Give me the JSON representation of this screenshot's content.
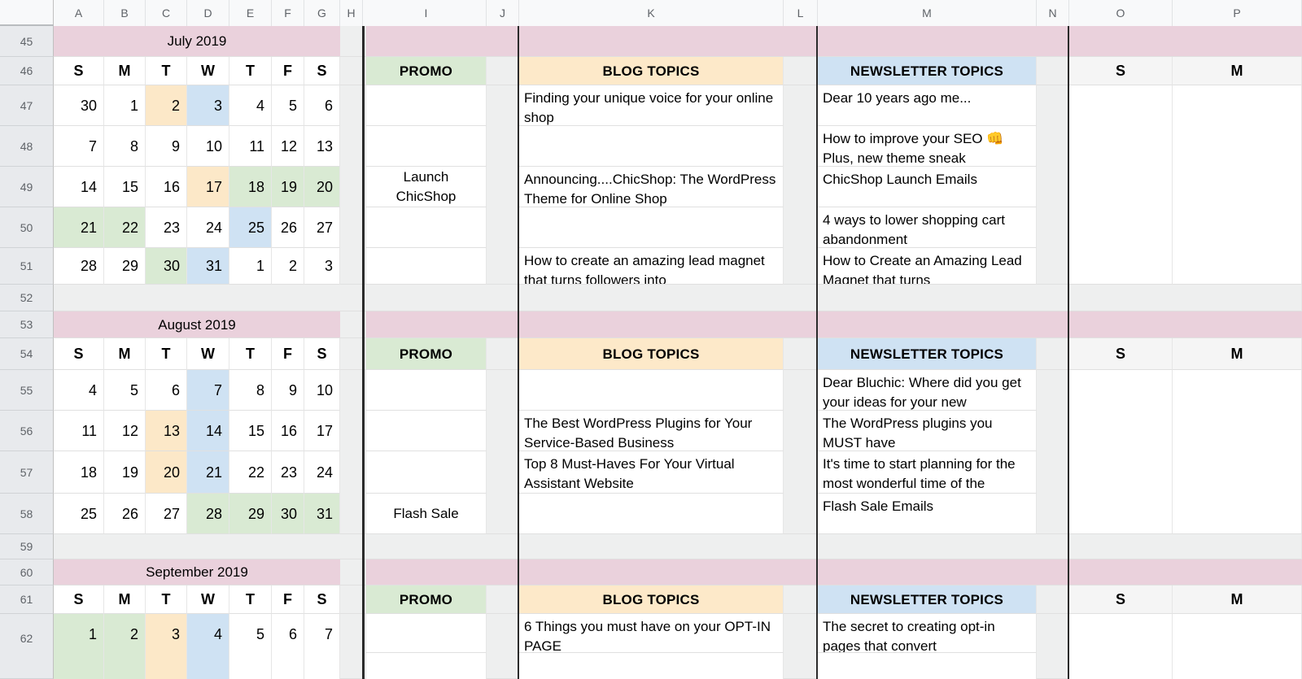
{
  "app": {
    "type": "spreadsheet",
    "title": "Content Calendar"
  },
  "colors": {
    "month_band": "#ead1dc",
    "promo_header": "#d9ead3",
    "blog_header": "#fde9c9",
    "newsletter_header": "#cfe2f3",
    "highlight_green": "#d9ead3",
    "highlight_orange": "#fce8c8",
    "highlight_blue": "#cfe2f3",
    "gutter": "#eeefef",
    "header_bar": "#f8f9fa",
    "row_header": "#e8eaed"
  },
  "column_headers": [
    "A",
    "B",
    "C",
    "D",
    "E",
    "F",
    "G",
    "H",
    "I",
    "J",
    "K",
    "L",
    "M",
    "N",
    "O",
    "P"
  ],
  "row_headers": [
    "45",
    "46",
    "47",
    "48",
    "49",
    "50",
    "51",
    "52",
    "53",
    "54",
    "55",
    "56",
    "57",
    "58",
    "59",
    "60",
    "61",
    "62"
  ],
  "day_initials": [
    "S",
    "M",
    "T",
    "W",
    "T",
    "F",
    "S"
  ],
  "section_labels": {
    "promo": "PROMO",
    "blog": "BLOG TOPICS",
    "newsletter": "NEWSLETTER TOPICS"
  },
  "right_headers": {
    "o": "S",
    "p": "M"
  },
  "months": [
    {
      "title": "July 2019",
      "title_row": "45",
      "weeks": [
        {
          "row": "47",
          "days": [
            {
              "v": "30",
              "fill": "none"
            },
            {
              "v": "1",
              "fill": "none"
            },
            {
              "v": "2",
              "fill": "orange"
            },
            {
              "v": "3",
              "fill": "blue"
            },
            {
              "v": "4",
              "fill": "none"
            },
            {
              "v": "5",
              "fill": "none"
            },
            {
              "v": "6",
              "fill": "none"
            }
          ]
        },
        {
          "row": "48",
          "days": [
            {
              "v": "7",
              "fill": "none"
            },
            {
              "v": "8",
              "fill": "none"
            },
            {
              "v": "9",
              "fill": "none"
            },
            {
              "v": "10",
              "fill": "none"
            },
            {
              "v": "11",
              "fill": "none"
            },
            {
              "v": "12",
              "fill": "none"
            },
            {
              "v": "13",
              "fill": "none"
            }
          ]
        },
        {
          "row": "49",
          "days": [
            {
              "v": "14",
              "fill": "none"
            },
            {
              "v": "15",
              "fill": "none"
            },
            {
              "v": "16",
              "fill": "none"
            },
            {
              "v": "17",
              "fill": "orange"
            },
            {
              "v": "18",
              "fill": "green"
            },
            {
              "v": "19",
              "fill": "green"
            },
            {
              "v": "20",
              "fill": "green"
            }
          ]
        },
        {
          "row": "50",
          "days": [
            {
              "v": "21",
              "fill": "green"
            },
            {
              "v": "22",
              "fill": "green"
            },
            {
              "v": "23",
              "fill": "none"
            },
            {
              "v": "24",
              "fill": "none"
            },
            {
              "v": "25",
              "fill": "blue"
            },
            {
              "v": "26",
              "fill": "none"
            },
            {
              "v": "27",
              "fill": "none"
            }
          ]
        },
        {
          "row": "51",
          "days": [
            {
              "v": "28",
              "fill": "none"
            },
            {
              "v": "29",
              "fill": "none"
            },
            {
              "v": "30",
              "fill": "green"
            },
            {
              "v": "31",
              "fill": "blue"
            },
            {
              "v": "1",
              "fill": "none"
            },
            {
              "v": "2",
              "fill": "none"
            },
            {
              "v": "3",
              "fill": "none"
            }
          ]
        }
      ],
      "promo": [
        "",
        "",
        "Launch\nChicShop",
        "",
        ""
      ],
      "blog": [
        "Finding your unique voice for your online shop",
        "",
        "Announcing....ChicShop: The WordPress Theme for Online Shop",
        "",
        "How to create an amazing lead magnet that turns followers into"
      ],
      "newsletter": [
        "Dear 10 years ago me...",
        "How to improve your SEO 👊 Plus, new theme sneak",
        "ChicShop Launch Emails",
        "4 ways to lower shopping cart abandonment",
        "How to Create an Amazing Lead Magnet that turns"
      ]
    },
    {
      "title": "August 2019",
      "title_row": "53",
      "weeks": [
        {
          "row": "55",
          "days": [
            {
              "v": "4",
              "fill": "none"
            },
            {
              "v": "5",
              "fill": "none"
            },
            {
              "v": "6",
              "fill": "none"
            },
            {
              "v": "7",
              "fill": "blue"
            },
            {
              "v": "8",
              "fill": "none"
            },
            {
              "v": "9",
              "fill": "none"
            },
            {
              "v": "10",
              "fill": "none"
            }
          ]
        },
        {
          "row": "56",
          "days": [
            {
              "v": "11",
              "fill": "none"
            },
            {
              "v": "12",
              "fill": "none"
            },
            {
              "v": "13",
              "fill": "orange"
            },
            {
              "v": "14",
              "fill": "blue"
            },
            {
              "v": "15",
              "fill": "none"
            },
            {
              "v": "16",
              "fill": "none"
            },
            {
              "v": "17",
              "fill": "none"
            }
          ]
        },
        {
          "row": "57",
          "days": [
            {
              "v": "18",
              "fill": "none"
            },
            {
              "v": "19",
              "fill": "none"
            },
            {
              "v": "20",
              "fill": "orange"
            },
            {
              "v": "21",
              "fill": "blue"
            },
            {
              "v": "22",
              "fill": "none"
            },
            {
              "v": "23",
              "fill": "none"
            },
            {
              "v": "24",
              "fill": "none"
            }
          ]
        },
        {
          "row": "58",
          "days": [
            {
              "v": "25",
              "fill": "none"
            },
            {
              "v": "26",
              "fill": "none"
            },
            {
              "v": "27",
              "fill": "none"
            },
            {
              "v": "28",
              "fill": "green"
            },
            {
              "v": "29",
              "fill": "green"
            },
            {
              "v": "30",
              "fill": "green"
            },
            {
              "v": "31",
              "fill": "green"
            }
          ]
        }
      ],
      "promo": [
        "",
        "",
        "",
        "Flash Sale"
      ],
      "blog": [
        "",
        "The Best WordPress Plugins for Your Service-Based Business",
        "Top 8 Must-Haves For Your Virtual Assistant Website",
        ""
      ],
      "newsletter": [
        "Dear Bluchic: Where did you get your ideas for your new",
        "The WordPress plugins you MUST have",
        " It's time to start planning for the most wonderful time of the",
        "Flash Sale Emails"
      ]
    },
    {
      "title": "September 2019",
      "title_row": "60",
      "weeks": [
        {
          "row": "62",
          "days": [
            {
              "v": "1",
              "fill": "green"
            },
            {
              "v": "2",
              "fill": "green"
            },
            {
              "v": "3",
              "fill": "orange"
            },
            {
              "v": "4",
              "fill": "blue"
            },
            {
              "v": "5",
              "fill": "none"
            },
            {
              "v": "6",
              "fill": "none"
            },
            {
              "v": "7",
              "fill": "none"
            }
          ]
        }
      ],
      "promo": [
        ""
      ],
      "blog": [
        "6 Things you must have on your OPT-IN PAGE"
      ],
      "newsletter": [
        "The secret to creating opt-in pages that convert"
      ]
    }
  ]
}
